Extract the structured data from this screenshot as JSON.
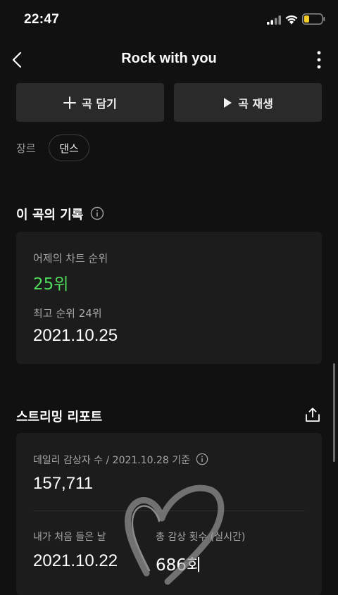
{
  "status_bar": {
    "time": "22:47"
  },
  "nav": {
    "title": "Rock with you"
  },
  "actions": {
    "add_label": "곡 담기",
    "play_label": "곡 재생"
  },
  "genre": {
    "label": "장르",
    "chip": "댄스"
  },
  "history": {
    "title": "이 곡의 기록",
    "yesterday_rank_label": "어제의 차트 순위",
    "yesterday_rank_value": "25위",
    "best_rank_label": "최고 순위 24위",
    "best_rank_date": "2021.10.25"
  },
  "report": {
    "title": "스트리밍 리포트",
    "daily_listeners_label": "데일리 감상자 수 / 2021.10.28 기준",
    "daily_listeners_value": "157,711",
    "first_listen_label": "내가 처음 들은 날",
    "first_listen_value": "2021.10.22",
    "total_plays_label": "총 감상 횟수 (실시간)",
    "total_plays_value": "686회"
  },
  "colors": {
    "background": "#111111",
    "card": "#1c1c1c",
    "accent_green": "#4fdc5c",
    "battery_yellow": "#f4cd2a"
  }
}
